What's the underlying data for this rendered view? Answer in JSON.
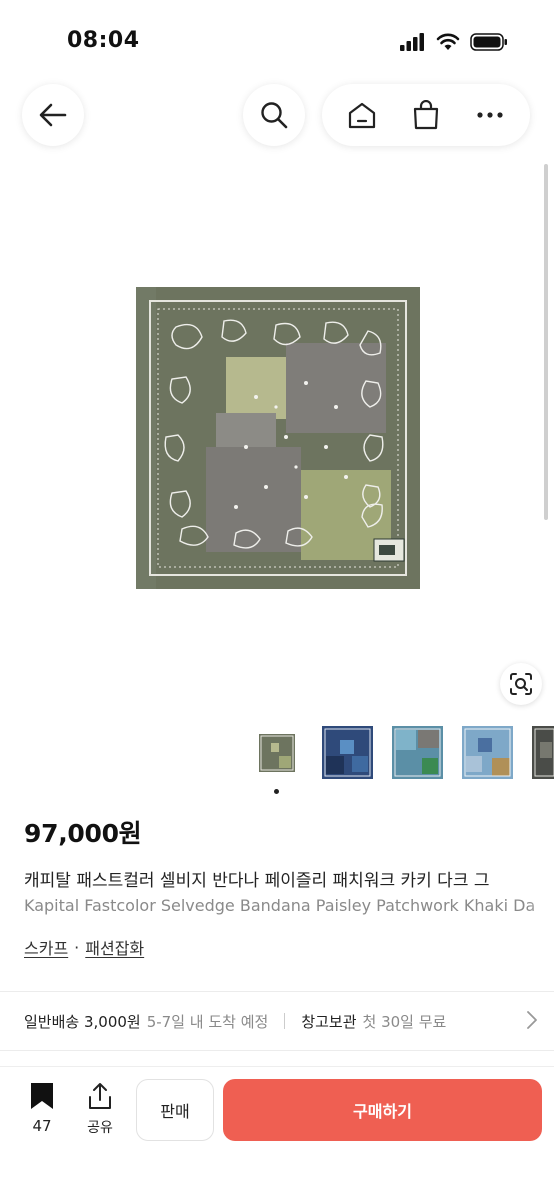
{
  "status_bar": {
    "time": "08:04"
  },
  "nav": {
    "back_icon": "arrow-left-icon",
    "search_icon": "search-icon",
    "home_icon": "home-icon",
    "shop_icon": "shopping-bag-icon",
    "more_icon": "more-icon"
  },
  "gallery": {
    "thumbnail_count": 5,
    "active_index": 0
  },
  "product": {
    "price": "97,000원",
    "title_ko": "캐피탈 패스트컬러 셀비지 반다나 페이즐리 패치워크 카키 다크 그",
    "title_en": "Kapital Fastcolor Selvedge Bandana Paisley Patchwork Khaki Da",
    "category_1": "스카프",
    "category_sep": "·",
    "category_2": "패션잡화"
  },
  "shipping": {
    "label": "일반배송 3,000원",
    "eta": "5-7일 내 도착 예정",
    "storage_label": "창고보관",
    "storage_note": "첫 30일 무료"
  },
  "bottom_bar": {
    "bookmark_count": "47",
    "share_label": "공유",
    "sell_label": "판매",
    "buy_label": "구매하기"
  },
  "colors": {
    "accent": "#ef5f52",
    "text": "#222222",
    "muted": "#8a8a8a"
  }
}
